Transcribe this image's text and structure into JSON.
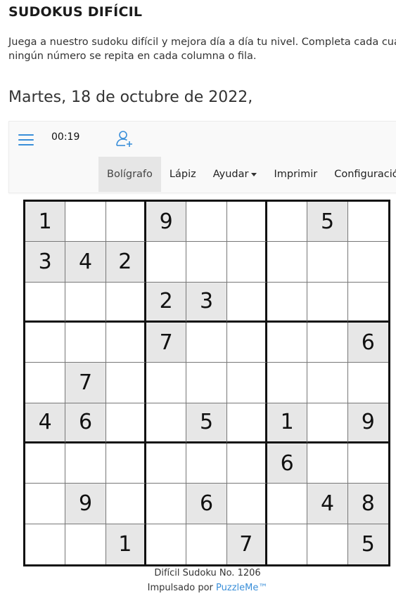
{
  "page": {
    "title": "SUDOKUS DIFÍCIL",
    "description_line1": "Juega a nuestro sudoku difícil y mejora día a día tu nivel. Completa cada cua",
    "description_line2": "ningún número se repita en cada columna o fila.",
    "date": "Martes, 18 de octubre de 2022,"
  },
  "toolbar": {
    "menu_icon": "hamburger-menu-icon",
    "timer": "00:19",
    "add_user_icon": "add-user-icon",
    "accent_color": "#3a8fd9",
    "menu": [
      {
        "label": "Bolígrafo",
        "active": true
      },
      {
        "label": "Lápiz",
        "active": false
      },
      {
        "label": "Ayudar",
        "active": false,
        "dropdown": true
      },
      {
        "label": "Imprimir",
        "active": false
      },
      {
        "label": "Configuración",
        "active": false
      }
    ]
  },
  "puzzle": {
    "grid": [
      [
        1,
        0,
        0,
        9,
        0,
        0,
        0,
        5,
        0
      ],
      [
        3,
        4,
        2,
        0,
        0,
        0,
        0,
        0,
        0
      ],
      [
        0,
        0,
        0,
        2,
        3,
        0,
        0,
        0,
        0
      ],
      [
        0,
        0,
        0,
        7,
        0,
        0,
        0,
        0,
        6
      ],
      [
        0,
        7,
        0,
        0,
        0,
        0,
        0,
        0,
        0
      ],
      [
        4,
        6,
        0,
        0,
        5,
        0,
        1,
        0,
        9
      ],
      [
        0,
        0,
        0,
        0,
        0,
        0,
        6,
        0,
        0
      ],
      [
        0,
        9,
        0,
        0,
        6,
        0,
        0,
        4,
        8
      ],
      [
        0,
        0,
        1,
        0,
        0,
        7,
        0,
        0,
        5
      ]
    ],
    "given_cell_color": "#e7e7e7"
  },
  "footer": {
    "puzzle_name": "Difícil Sudoku No. 1206",
    "powered_prefix": "Impulsado por ",
    "powered_link": "PuzzleMe™"
  }
}
